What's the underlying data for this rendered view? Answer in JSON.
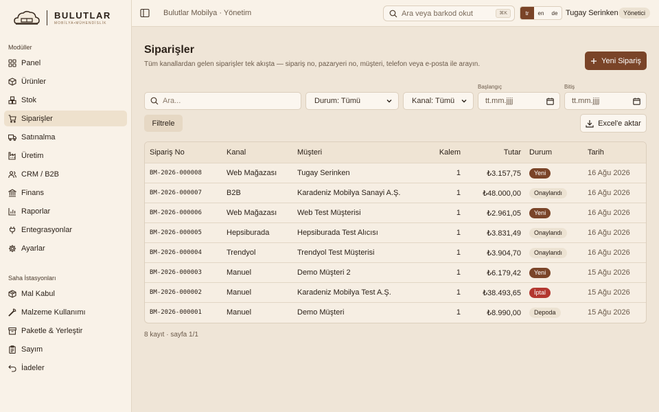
{
  "brand": {
    "title": "BULUTLAR",
    "subtitle": "MOBİLYA•MÜHENDİSLİK"
  },
  "sidebar": {
    "section1": "Modüller",
    "modules": [
      {
        "label": "Panel",
        "icon": "grid-icon"
      },
      {
        "label": "Ürünler",
        "icon": "box-icon"
      },
      {
        "label": "Stok",
        "icon": "boxes-icon"
      },
      {
        "label": "Siparişler",
        "icon": "cart-icon",
        "active": true
      },
      {
        "label": "Satınalma",
        "icon": "truck-icon"
      },
      {
        "label": "Üretim",
        "icon": "factory-icon"
      },
      {
        "label": "CRM / B2B",
        "icon": "users-icon"
      },
      {
        "label": "Finans",
        "icon": "bank-icon"
      },
      {
        "label": "Raporlar",
        "icon": "chart-icon"
      },
      {
        "label": "Entegrasyonlar",
        "icon": "plug-icon"
      },
      {
        "label": "Ayarlar",
        "icon": "gear-icon"
      }
    ],
    "section2": "Saha İstasyonları",
    "stations": [
      {
        "label": "Mal Kabul",
        "icon": "package-icon"
      },
      {
        "label": "Malzeme Kullanımı",
        "icon": "wrench-icon"
      },
      {
        "label": "Paketle & Yerleştir",
        "icon": "archive-icon"
      },
      {
        "label": "Sayım",
        "icon": "clipboard-icon"
      },
      {
        "label": "İadeler",
        "icon": "undo-icon"
      }
    ]
  },
  "topbar": {
    "breadcrumb": "Bulutlar Mobilya · Yönetim",
    "search_placeholder": "Ara veya barkod okut",
    "shortcut": "⌘K",
    "languages": [
      "tr",
      "en",
      "de"
    ],
    "active_language": "tr",
    "user_name": "Tugay Serinken",
    "user_role": "Yönetici"
  },
  "page": {
    "title": "Siparişler",
    "description": "Tüm kanallardan gelen siparişler tek akışta — sipariş no, pazaryeri no, müşteri, telefon veya e-posta ile arayın.",
    "new_button": "Yeni Sipariş"
  },
  "filters": {
    "search_placeholder": "Ara...",
    "status": "Durum: Tümü",
    "channel": "Kanal: Tümü",
    "start_label": "Başlangıç",
    "end_label": "Bitiş",
    "date_placeholder": "tt.mm.jjjj",
    "filter_button": "Filtrele",
    "excel_button": "Excel'e aktar"
  },
  "table": {
    "headers": [
      "Sipariş No",
      "Kanal",
      "Müşteri",
      "Kalem",
      "Tutar",
      "Durum",
      "Tarih"
    ],
    "rows": [
      {
        "no": "BM-2026-000008",
        "kanal": "Web Mağazası",
        "musteri": "Tugay Serinken",
        "kalem": "1",
        "tutar": "₺3.157,75",
        "durum": "Yeni",
        "durum_type": "yeni",
        "tarih": "16 Ağu 2026"
      },
      {
        "no": "BM-2026-000007",
        "kanal": "B2B",
        "musteri": "Karadeniz Mobilya Sanayi A.Ş.",
        "kalem": "1",
        "tutar": "₺48.000,00",
        "durum": "Onaylandı",
        "durum_type": "onay",
        "tarih": "16 Ağu 2026"
      },
      {
        "no": "BM-2026-000006",
        "kanal": "Web Mağazası",
        "musteri": "Web Test Müşterisi",
        "kalem": "1",
        "tutar": "₺2.961,05",
        "durum": "Yeni",
        "durum_type": "yeni",
        "tarih": "16 Ağu 2026"
      },
      {
        "no": "BM-2026-000005",
        "kanal": "Hepsiburada",
        "musteri": "Hepsiburada Test Alıcısı",
        "kalem": "1",
        "tutar": "₺3.831,49",
        "durum": "Onaylandı",
        "durum_type": "onay",
        "tarih": "16 Ağu 2026"
      },
      {
        "no": "BM-2026-000004",
        "kanal": "Trendyol",
        "musteri": "Trendyol Test Müşterisi",
        "kalem": "1",
        "tutar": "₺3.904,70",
        "durum": "Onaylandı",
        "durum_type": "onay",
        "tarih": "16 Ağu 2026"
      },
      {
        "no": "BM-2026-000003",
        "kanal": "Manuel",
        "musteri": "Demo Müşteri 2",
        "kalem": "1",
        "tutar": "₺6.179,42",
        "durum": "Yeni",
        "durum_type": "yeni",
        "tarih": "15 Ağu 2026"
      },
      {
        "no": "BM-2026-000002",
        "kanal": "Manuel",
        "musteri": "Karadeniz Mobilya Test A.Ş.",
        "kalem": "1",
        "tutar": "₺38.493,65",
        "durum": "İptal",
        "durum_type": "iptal",
        "tarih": "15 Ağu 2026"
      },
      {
        "no": "BM-2026-000001",
        "kanal": "Manuel",
        "musteri": "Demo Müşteri",
        "kalem": "1",
        "tutar": "₺8.990,00",
        "durum": "Depoda",
        "durum_type": "depo",
        "tarih": "15 Ağu 2026"
      }
    ]
  },
  "footer": {
    "summary": "8 kayıt · sayfa 1/1"
  },
  "colors": {
    "accent": "#7a4428",
    "danger": "#b3372f",
    "background": "#efe5d7",
    "sidebar": "#f9f2e8"
  }
}
